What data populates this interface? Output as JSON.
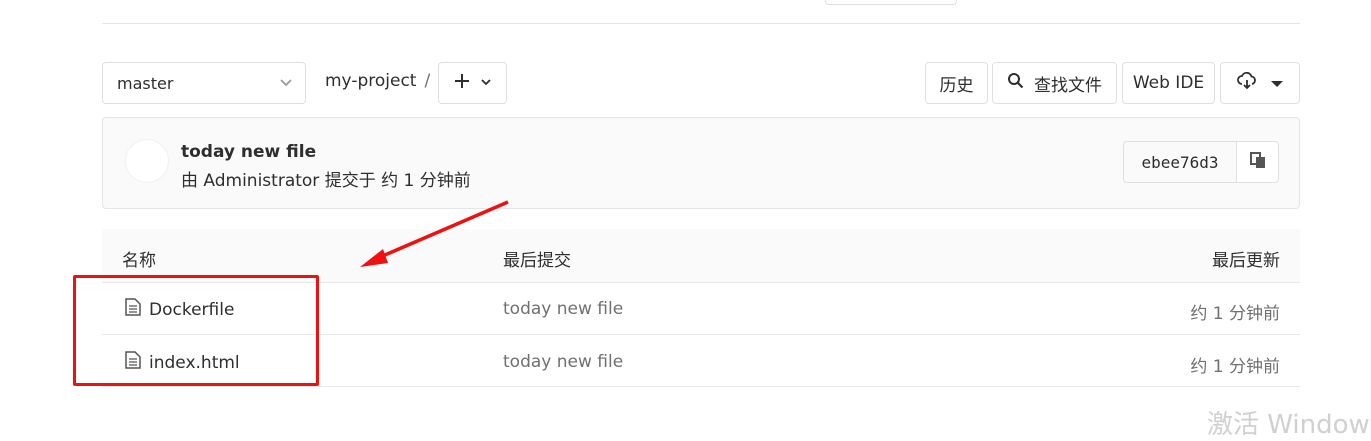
{
  "toolbar": {
    "branch": "master",
    "project": "my-project",
    "separator": "/",
    "plus_icon": "plus-icon",
    "history_label": "历史",
    "find_label": "查找文件",
    "webide_label": "Web IDE",
    "clone_icon": "cloud-download-icon"
  },
  "commit": {
    "title": "today new file",
    "subtitle": "由 Administrator 提交于 约 1 分钟前",
    "sha": "ebee76d3"
  },
  "table": {
    "headers": [
      "名称",
      "最后提交",
      "最后更新"
    ],
    "rows": [
      {
        "name": "Dockerfile",
        "message": "today new file",
        "updated": "约 1 分钟前"
      },
      {
        "name": "index.html",
        "message": "today new file",
        "updated": "约 1 分钟前"
      }
    ]
  },
  "overlay": {
    "watermark": "激活 Windows",
    "annotation_color": "#ee1111"
  }
}
